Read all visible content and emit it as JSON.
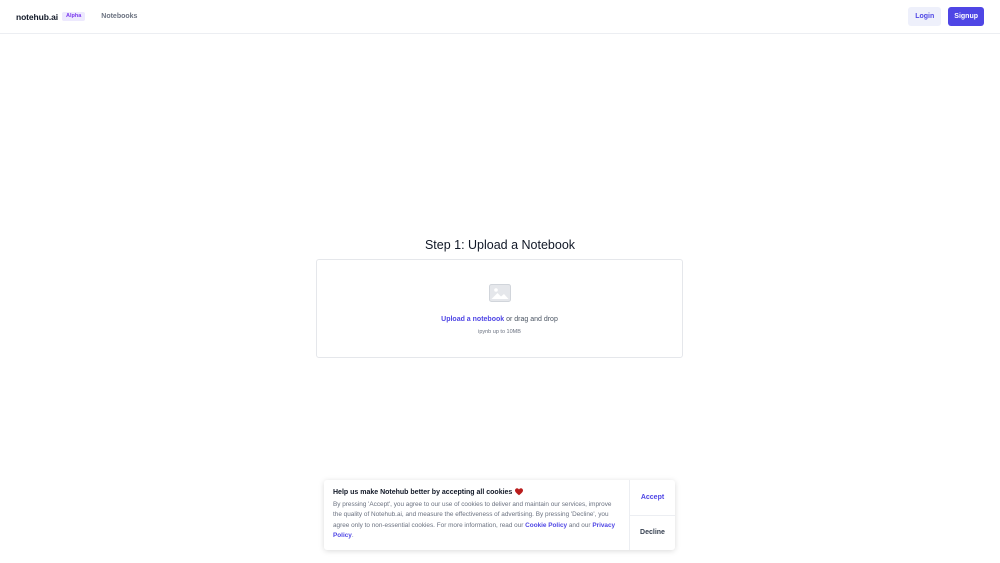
{
  "header": {
    "brand": "notehub.ai",
    "badge": "Alpha",
    "nav": [
      "Notebooks"
    ],
    "login_label": "Login",
    "signup_label": "Signup"
  },
  "main": {
    "title": "Step 1: Upload a Notebook",
    "upload_link": "Upload a notebook",
    "upload_text": " or drag and drop",
    "hint": "ipynb up to 10MB"
  },
  "cookie": {
    "title": "Help us make Notehub better by accepting all cookies",
    "text": "By pressing 'Accept', you agree to our use of cookies to deliver and maintain our services, improve the quality of Notehub.ai, and measure the effectiveness of advertising. By pressing 'Decline', you agree only to non-essential cookies. For more information, read our ",
    "cookie_policy": "Cookie Policy",
    "and_our": " and our ",
    "privacy_policy": "Privacy Policy",
    "period": ".",
    "accept_label": "Accept",
    "decline_label": "Decline"
  },
  "colors": {
    "accent": "#4f46e5",
    "badge_text": "#7c3aed",
    "badge_bg": "#ede9fe",
    "heart": "#b91c1c"
  },
  "icons": {
    "upload": "image-placeholder-icon",
    "heart": "heart-icon"
  }
}
